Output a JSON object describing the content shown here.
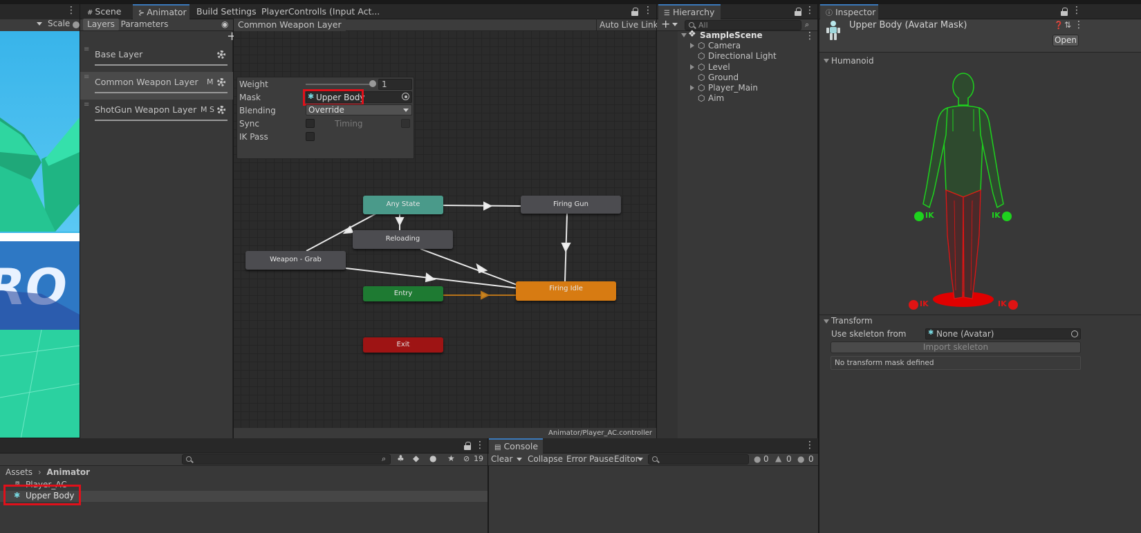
{
  "scene_view": {
    "scale_label": "Scale"
  },
  "animator_window": {
    "tabs": [
      {
        "label": "Scene",
        "icon": "grid-icon"
      },
      {
        "label": "Animator",
        "icon": "animator-icon"
      },
      {
        "label": "Build Settings"
      },
      {
        "label": "PlayerControlls (Input Act..."
      }
    ],
    "side_tabs": {
      "layers": "Layers",
      "parameters": "Parameters"
    },
    "breadcrumb": "Common Weapon Layer",
    "auto_live_link": "Auto Live Link",
    "layers": [
      {
        "name": "Base Layer",
        "badges": ""
      },
      {
        "name": "Common Weapon Layer",
        "badges": "M"
      },
      {
        "name": "ShotGun Weapon Layer",
        "badges": "M S"
      }
    ],
    "layer_settings": {
      "weight_label": "Weight",
      "weight_value": "1",
      "mask_label": "Mask",
      "mask_value": "Upper Body",
      "blending_label": "Blending",
      "blending_value": "Override",
      "sync_label": "Sync",
      "timing_label": "Timing",
      "ik_pass_label": "IK Pass"
    },
    "states": {
      "any_state": "Any State",
      "firing_gun": "Firing Gun",
      "reloading": "Reloading",
      "weapon_grab": "Weapon - Grab",
      "entry": "Entry",
      "firing_idle": "Firing Idle",
      "exit": "Exit"
    },
    "footer_path": "Animator/Player_AC.controller"
  },
  "hierarchy": {
    "tab_label": "Hierarchy",
    "search_placeholder": "All",
    "scene_name": "SampleScene",
    "items": [
      {
        "label": "Camera",
        "expandable": true
      },
      {
        "label": "Directional Light",
        "expandable": false
      },
      {
        "label": "Level",
        "expandable": true
      },
      {
        "label": "Ground",
        "expandable": false
      },
      {
        "label": "Player_Main",
        "expandable": true
      },
      {
        "label": "Aim",
        "expandable": false
      }
    ]
  },
  "inspector": {
    "tab_label": "Inspector",
    "title": "Upper Body (Avatar Mask)",
    "open_button": "Open",
    "humanoid_section": "Humanoid",
    "ik_label": "IK",
    "transform_section": "Transform",
    "use_skeleton_label": "Use skeleton from",
    "skeleton_value": "None (Avatar)",
    "import_skeleton": "Import skeleton",
    "no_mask_message": "No transform mask defined",
    "colors": {
      "active": "#1ed21e",
      "inactive": "#e01414"
    }
  },
  "project": {
    "breadcrumb_root": "Assets",
    "breadcrumb_current": "Animator",
    "hidden_count": "19",
    "items": [
      {
        "label": "Player_AC"
      },
      {
        "label": "Upper Body"
      }
    ]
  },
  "console": {
    "tab_label": "Console",
    "clear": "Clear",
    "collapse": "Collapse",
    "error_pause": "Error Pause",
    "editor": "Editor",
    "log_count": "0",
    "warning_count": "0",
    "error_count": "0"
  }
}
